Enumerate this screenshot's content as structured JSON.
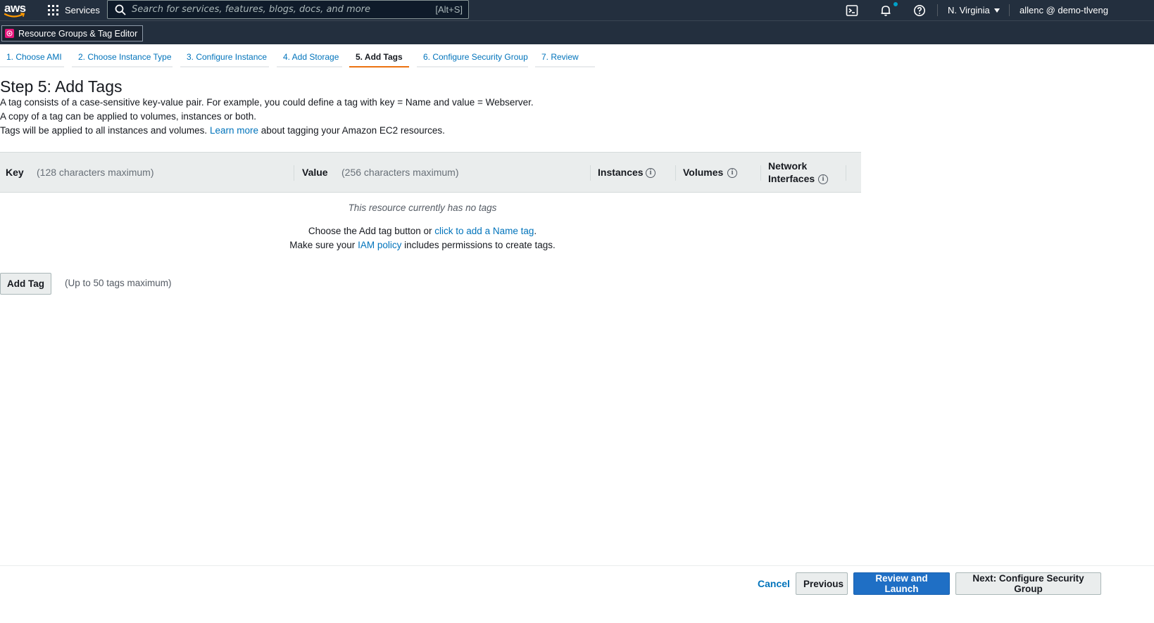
{
  "topnav": {
    "logo_text": "aws",
    "services_label": "Services",
    "search_placeholder": "Search for services, features, blogs, docs, and more",
    "search_shortcut": "[Alt+S]",
    "region": "N. Virginia",
    "account": "allenc @ demo-tlveng",
    "icons": [
      "cloudshell-icon",
      "bell-icon",
      "help-icon"
    ]
  },
  "favorites": {
    "items": [
      {
        "label": "Resource Groups & Tag Editor",
        "icon": "resource-groups-icon"
      }
    ]
  },
  "tabs": [
    {
      "label": "1. Choose AMI",
      "active": false
    },
    {
      "label": "2. Choose Instance Type",
      "active": false
    },
    {
      "label": "3. Configure Instance",
      "active": false
    },
    {
      "label": "4. Add Storage",
      "active": false
    },
    {
      "label": "5. Add Tags",
      "active": true
    },
    {
      "label": "6. Configure Security Group",
      "active": false
    },
    {
      "label": "7. Review",
      "active": false
    }
  ],
  "page": {
    "title": "Step 5: Add Tags",
    "desc1": "A tag consists of a case-sensitive key-value pair. For example, you could define a tag with key = Name and value = Webserver.",
    "desc2": "A copy of a tag can be applied to volumes, instances or both.",
    "desc3_prefix": "Tags will be applied to all instances and volumes.",
    "desc3_link": "Learn more",
    "desc3_suffix": "about tagging your Amazon EC2 resources."
  },
  "table": {
    "key_label": "Key",
    "key_hint": "(128 characters maximum)",
    "value_label": "Value",
    "value_hint": "(256 characters maximum)",
    "instances_label": "Instances",
    "volumes_label": "Volumes",
    "network_label_1": "Network",
    "network_label_2": "Interfaces"
  },
  "empty": {
    "message": "This resource currently has no tags",
    "line1_prefix": "Choose the Add tag button or",
    "line1_link": "click to add a Name tag",
    "line1_suffix": ".",
    "line2_prefix": "Make sure your",
    "line2_link": "IAM policy",
    "line2_suffix": "includes permissions to create tags."
  },
  "add_tag": {
    "button": "Add Tag",
    "hint": "(Up to 50 tags maximum)"
  },
  "footer": {
    "cancel": "Cancel",
    "previous": "Previous",
    "review_launch": "Review and Launch",
    "next": "Next: Configure Security Group"
  },
  "colors": {
    "nav_bg": "#232f3e",
    "link": "#0073bb",
    "active_tab": "#ec7211",
    "primary_button": "#1f6fc5",
    "notification_dot": "#00a1c9"
  }
}
